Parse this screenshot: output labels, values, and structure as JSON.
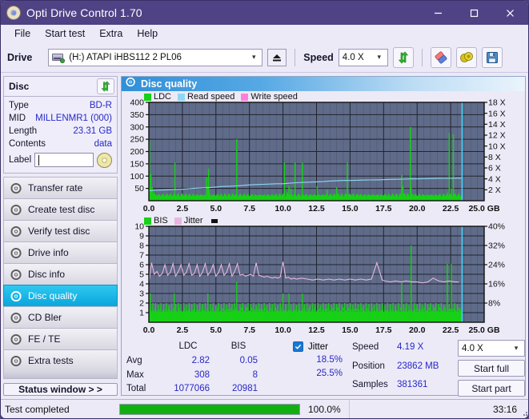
{
  "window": {
    "title": "Opti Drive Control 1.70",
    "icon": "disc-icon",
    "minimize": "minimize-icon",
    "maximize": "maximize-icon",
    "close": "close-icon"
  },
  "menu": {
    "items": [
      "File",
      "Start test",
      "Extra",
      "Help"
    ]
  },
  "toolbar": {
    "drive_label": "Drive",
    "drive_value": "(H:)  ATAPI iHBS112  2 PL06",
    "eject_icon": "eject-icon",
    "speed_label": "Speed",
    "speed_value": "4.0 X",
    "refresh_icon": "refresh-icon",
    "erase_icon": "eraser-icon",
    "coins_icon": "coins-icon",
    "save_icon": "save-icon"
  },
  "disc": {
    "header": "Disc",
    "refresh_icon": "refresh-icon",
    "rows": [
      {
        "key": "Type",
        "value": "BD-R"
      },
      {
        "key": "MID",
        "value": "MILLENMR1 (000)"
      },
      {
        "key": "Length",
        "value": "23.31 GB"
      },
      {
        "key": "Contents",
        "value": "data"
      }
    ],
    "label_key": "Label",
    "label_value": "",
    "label_placeholder": "",
    "disc_icon": "cd-icon"
  },
  "nav": {
    "items": [
      {
        "label": "Transfer rate",
        "icon": "disc-icon",
        "active": false
      },
      {
        "label": "Create test disc",
        "icon": "disc-icon",
        "active": false
      },
      {
        "label": "Verify test disc",
        "icon": "disc-icon",
        "active": false
      },
      {
        "label": "Drive info",
        "icon": "disc-icon",
        "active": false
      },
      {
        "label": "Disc info",
        "icon": "disc-icon",
        "active": false
      },
      {
        "label": "Disc quality",
        "icon": "disc-icon",
        "active": true
      },
      {
        "label": "CD Bler",
        "icon": "disc-icon",
        "active": false
      },
      {
        "label": "FE / TE",
        "icon": "disc-icon",
        "active": false
      },
      {
        "label": "Extra tests",
        "icon": "disc-icon",
        "active": false
      }
    ],
    "status_window": "Status window > >"
  },
  "panel": {
    "title": "Disc quality",
    "icon": "disc-icon"
  },
  "stats": {
    "columns": [
      "LDC",
      "BIS"
    ],
    "rows": [
      {
        "key": "Avg",
        "ldc": "2.82",
        "bis": "0.05"
      },
      {
        "key": "Max",
        "ldc": "308",
        "bis": "8"
      },
      {
        "key": "Total",
        "ldc": "1077066",
        "bis": "20981"
      }
    ],
    "jitter_label": "Jitter",
    "jitter_checked": true,
    "jitter_avg": "18.5%",
    "jitter_max": "25.5%",
    "speed_key": "Speed",
    "speed_value": "4.19 X",
    "position_key": "Position",
    "position_value": "23862 MB",
    "samples_key": "Samples",
    "samples_value": "381361",
    "speed_select": "4.0 X",
    "start_full": "Start full",
    "start_part": "Start part"
  },
  "statusbar": {
    "text": "Test completed",
    "progress": 100,
    "percent": "100.0%",
    "time": "33:16"
  },
  "colors": {
    "titlebar": "#4f4285",
    "accent_blue": "#2828c8",
    "ldc_green": "#17d017",
    "read_speed": "#8fd8f5",
    "write_speed": "#ff7fe0",
    "jitter_pink": "#e8b6e0",
    "plot_bg": "#5f6b89",
    "progress_green": "#11b011",
    "active_nav": "#0aa6dc"
  },
  "chart_data": [
    {
      "type": "line",
      "title": "LDC / Read speed / Write speed",
      "xlabel": "GB",
      "ylabel": "LDC",
      "y2label": "X",
      "xlim": [
        0,
        25
      ],
      "ylim": [
        0,
        400
      ],
      "y2lim": [
        0,
        18
      ],
      "grid": true,
      "legend": [
        "LDC",
        "Read speed",
        "Write speed"
      ],
      "legend_position": "top-left",
      "xticks": [
        "0.0",
        "2.5",
        "5.0",
        "7.5",
        "10.0",
        "12.5",
        "15.0",
        "17.5",
        "20.0",
        "22.5",
        "25.0 GB"
      ],
      "yticks": [
        "50",
        "100",
        "150",
        "200",
        "250",
        "300",
        "350",
        "400"
      ],
      "y2ticks": [
        "2 X",
        "4 X",
        "6 X",
        "8 X",
        "10 X",
        "12 X",
        "14 X",
        "16 X",
        "18 X"
      ],
      "series": [
        {
          "name": "LDC",
          "color": "#17d017",
          "kind": "impulse",
          "x": [
            0.05,
            0.1,
            0.15,
            0.2,
            0.25,
            0.3,
            0.35,
            0.4,
            0.5,
            0.6,
            0.7,
            0.8,
            0.9,
            1.0,
            1.1,
            1.2,
            1.3,
            1.4,
            1.5,
            1.6,
            1.7,
            1.8,
            1.95,
            2.0,
            2.1,
            2.2,
            2.4,
            2.6,
            2.8,
            3.0,
            3.2,
            3.4,
            3.6,
            3.8,
            4.0,
            4.2,
            4.3,
            4.4,
            4.45,
            4.5,
            4.6,
            4.7,
            4.8,
            5.0,
            5.2,
            5.4,
            5.6,
            5.8,
            6.0,
            6.2,
            6.4,
            6.55,
            6.6,
            6.7,
            6.9,
            7.1,
            7.3,
            7.5,
            7.7,
            7.9,
            8.1,
            8.3,
            8.5,
            8.7,
            8.9,
            9.1,
            9.3,
            9.5,
            9.7,
            9.9,
            10.1,
            10.3,
            10.45,
            10.5,
            10.6,
            10.7,
            10.9,
            11.1,
            11.3,
            11.45,
            11.6,
            11.8,
            12.0,
            12.2,
            12.4,
            12.55,
            12.7,
            12.9,
            13.1,
            13.3,
            13.5,
            13.7,
            13.9,
            14.0,
            14.2,
            14.4,
            14.6,
            14.8,
            14.95,
            15.1,
            15.3,
            15.5,
            15.7,
            15.9,
            16.1,
            16.3,
            16.5,
            16.7,
            16.9,
            17.1,
            17.3,
            17.5,
            17.7,
            17.9,
            18.1,
            18.3,
            18.5,
            18.7,
            18.85,
            18.95,
            19.1,
            19.3,
            19.5,
            19.55,
            19.7,
            19.9,
            20.1,
            20.3,
            20.5,
            20.7,
            20.9,
            21.1,
            21.3,
            21.5,
            21.7,
            21.9,
            22.1,
            22.25,
            22.4,
            22.55,
            22.7,
            22.8,
            22.9,
            23.0,
            23.1,
            23.2
          ],
          "y": [
            245,
            60,
            110,
            40,
            55,
            30,
            25,
            35,
            20,
            22,
            18,
            20,
            18,
            22,
            18,
            20,
            18,
            25,
            20,
            22,
            18,
            20,
            155,
            22,
            18,
            20,
            18,
            22,
            20,
            18,
            20,
            18,
            22,
            20,
            18,
            20,
            95,
            60,
            130,
            45,
            20,
            22,
            18,
            20,
            22,
            18,
            20,
            18,
            22,
            18,
            20,
            250,
            22,
            18,
            20,
            22,
            18,
            20,
            22,
            18,
            20,
            22,
            18,
            20,
            22,
            18,
            20,
            22,
            18,
            20,
            155,
            35,
            60,
            25,
            50,
            20,
            155,
            22,
            18,
            155,
            20,
            22,
            18,
            20,
            22,
            60,
            20,
            18,
            22,
            45,
            20,
            18,
            22,
            55,
            20,
            22,
            18,
            155,
            20,
            22,
            18,
            20,
            22,
            18,
            20,
            22,
            18,
            20,
            22,
            18,
            20,
            22,
            18,
            20,
            22,
            18,
            20,
            22,
            105,
            60,
            30,
            22,
            300,
            55,
            25,
            22,
            18,
            20,
            22,
            18,
            20,
            22,
            18,
            20,
            22,
            18,
            20,
            32,
            275,
            50,
            270,
            28,
            20,
            18,
            15,
            12
          ]
        },
        {
          "name": "Read speed",
          "color": "#8fd8f5",
          "kind": "line",
          "x": [
            0.0,
            0.5,
            1.0,
            1.5,
            2.0,
            2.5,
            3.0,
            3.5,
            4.0,
            4.5,
            5.0,
            5.5,
            6.0,
            6.5,
            7.0,
            7.5,
            8.0,
            8.5,
            9.0,
            9.5,
            10.0,
            10.5,
            11.0,
            11.5,
            12.0,
            12.5,
            13.0,
            13.5,
            14.0,
            14.5,
            15.0,
            15.5,
            16.0,
            16.5,
            17.0,
            17.5,
            18.0,
            18.5,
            19.0,
            19.5,
            20.0,
            20.5,
            21.0,
            21.5,
            22.0,
            22.5,
            23.0,
            23.3
          ],
          "y_x_speed": [
            1.85,
            1.9,
            1.95,
            2.0,
            2.05,
            2.1,
            2.2,
            2.3,
            2.35,
            2.4,
            2.5,
            2.6,
            2.65,
            2.7,
            2.8,
            2.9,
            2.95,
            3.0,
            3.05,
            3.1,
            3.1,
            3.2,
            3.3,
            3.35,
            3.4,
            3.45,
            3.5,
            3.6,
            3.65,
            3.7,
            3.7,
            3.75,
            3.78,
            3.8,
            3.82,
            3.85,
            3.9,
            3.92,
            3.95,
            4.0,
            4.0,
            4.02,
            4.05,
            4.08,
            4.1,
            4.1,
            4.12,
            4.12
          ]
        },
        {
          "name": "Write speed",
          "color": "#ff7fe0",
          "kind": "line",
          "x": [],
          "y": []
        }
      ],
      "cursor_x": 23.35,
      "cursor_color": "#3fd0f5"
    },
    {
      "type": "line",
      "title": "BIS / Jitter",
      "xlabel": "GB",
      "ylabel": "BIS",
      "y2label": "%",
      "xlim": [
        0,
        25
      ],
      "ylim": [
        0,
        10
      ],
      "y2lim": [
        0,
        40
      ],
      "grid": true,
      "legend": [
        "BIS",
        "Jitter"
      ],
      "legend_position": "top-left",
      "xticks": [
        "0.0",
        "2.5",
        "5.0",
        "7.5",
        "10.0",
        "12.5",
        "15.0",
        "17.5",
        "20.0",
        "22.5",
        "25.0 GB"
      ],
      "yticks": [
        "1",
        "2",
        "3",
        "4",
        "5",
        "6",
        "7",
        "8",
        "9",
        "10"
      ],
      "y2ticks": [
        "8%",
        "16%",
        "24%",
        "32%",
        "40%"
      ],
      "series": [
        {
          "name": "BIS",
          "color": "#17d017",
          "kind": "impulse",
          "baseline": 1.1,
          "peaks_x": [
            0.1,
            0.3,
            0.5,
            0.7,
            0.9,
            1.1,
            1.3,
            1.5,
            1.7,
            1.9,
            2.0,
            2.2,
            2.4,
            2.6,
            2.8,
            3.0,
            3.2,
            3.4,
            3.6,
            3.8,
            4.0,
            4.2,
            4.4,
            4.6,
            4.8,
            5.0,
            5.2,
            5.4,
            5.6,
            5.8,
            6.0,
            6.2,
            6.4,
            6.55,
            6.8,
            7.0,
            7.2,
            7.4,
            7.6,
            7.8,
            8.0,
            8.2,
            8.4,
            8.6,
            8.8,
            9.0,
            9.2,
            9.4,
            9.6,
            9.8,
            10.0,
            10.2,
            10.45,
            10.6,
            10.8,
            11.0,
            11.2,
            11.45,
            11.6,
            11.8,
            12.0,
            12.2,
            12.4,
            12.6,
            12.8,
            13.0,
            13.2,
            13.4,
            13.6,
            13.8,
            14.0,
            14.2,
            14.4,
            14.6,
            14.8,
            15.0,
            15.2,
            15.4,
            15.6,
            15.8,
            16.0,
            16.2,
            16.4,
            16.6,
            16.8,
            17.0,
            17.2,
            17.4,
            17.6,
            17.8,
            18.0,
            18.2,
            18.4,
            18.6,
            18.85,
            19.0,
            19.2,
            19.4,
            19.55,
            19.8,
            20.0,
            20.2,
            20.4,
            20.6,
            20.8,
            21.0,
            21.2,
            21.4,
            21.6,
            21.8,
            22.0,
            22.25,
            22.4,
            22.55,
            22.8,
            23.0,
            23.2
          ],
          "peaks_y": [
            3.0,
            2.0,
            2.0,
            1.8,
            2.0,
            1.9,
            2.0,
            1.8,
            2.0,
            3.0,
            1.9,
            2.0,
            1.9,
            2.0,
            1.8,
            2.0,
            1.9,
            2.0,
            1.8,
            2.0,
            1.9,
            2.0,
            3.0,
            1.9,
            2.0,
            1.8,
            2.0,
            1.9,
            2.0,
            1.8,
            2.0,
            1.9,
            2.0,
            4.2,
            1.9,
            2.0,
            1.8,
            2.0,
            1.9,
            2.0,
            1.8,
            2.0,
            1.9,
            2.0,
            1.8,
            2.0,
            1.9,
            2.0,
            1.8,
            2.0,
            3.0,
            1.9,
            3.0,
            1.9,
            2.0,
            1.8,
            2.0,
            3.0,
            1.9,
            2.0,
            1.8,
            2.0,
            1.9,
            2.0,
            1.8,
            2.0,
            1.9,
            2.0,
            1.8,
            2.0,
            1.9,
            2.0,
            1.8,
            2.0,
            1.9,
            2.0,
            1.8,
            2.0,
            1.9,
            2.0,
            1.8,
            2.0,
            1.9,
            2.0,
            1.8,
            2.0,
            1.9,
            2.0,
            1.8,
            2.0,
            1.9,
            2.0,
            1.8,
            2.0,
            4.1,
            1.9,
            2.0,
            1.8,
            8.0,
            2.0,
            1.9,
            2.0,
            1.8,
            2.0,
            1.9,
            2.0,
            1.8,
            2.0,
            1.9,
            2.0,
            1.8,
            6.1,
            1.9,
            6.1,
            2.0,
            1.9,
            1.5
          ]
        },
        {
          "name": "Jitter",
          "color": "#e8b6e0",
          "kind": "line",
          "avg_pct": 18.5,
          "max_pct": 25.5,
          "x": [
            0.0,
            0.2,
            0.4,
            0.6,
            0.8,
            1.0,
            1.2,
            1.4,
            1.6,
            1.8,
            2.0,
            2.2,
            2.4,
            2.6,
            2.8,
            3.0,
            3.2,
            3.4,
            3.6,
            3.8,
            4.0,
            4.2,
            4.4,
            4.6,
            4.8,
            5.0,
            5.2,
            5.4,
            5.6,
            5.8,
            6.0,
            6.2,
            6.4,
            6.6,
            6.8,
            7.0,
            7.2,
            7.4,
            7.6,
            7.8,
            8.0,
            8.2,
            8.4,
            8.6,
            8.8,
            9.0,
            9.2,
            9.4,
            9.6,
            9.8,
            10.0,
            10.2,
            10.4,
            10.6,
            10.8,
            11.0,
            11.4,
            11.8,
            12.2,
            12.6,
            13.0,
            13.4,
            13.8,
            14.2,
            14.6,
            15.0,
            15.4,
            15.8,
            16.2,
            16.6,
            17.0,
            17.4,
            17.6,
            18.0,
            18.4,
            18.8,
            19.2,
            19.6,
            20.0,
            20.4,
            20.8,
            21.2,
            21.6,
            22.0,
            22.4,
            22.8,
            23.1
          ],
          "y_bis_scale": [
            4.1,
            6.2,
            5.0,
            5.3,
            4.8,
            5.1,
            6.0,
            4.9,
            5.2,
            6.1,
            4.8,
            5.3,
            6.0,
            4.9,
            5.2,
            6.1,
            4.9,
            5.1,
            6.0,
            4.8,
            5.2,
            6.1,
            4.9,
            5.3,
            6.0,
            4.8,
            5.2,
            6.0,
            4.9,
            5.2,
            6.1,
            4.8,
            5.3,
            6.1,
            4.9,
            5.0,
            4.8,
            4.9,
            5.0,
            4.8,
            6.2,
            4.9,
            4.8,
            4.7,
            4.8,
            4.7,
            4.6,
            4.7,
            4.6,
            4.7,
            6.3,
            4.6,
            4.7,
            4.5,
            4.6,
            4.5,
            4.6,
            4.5,
            4.4,
            4.5,
            4.4,
            4.5,
            4.4,
            4.5,
            4.4,
            4.5,
            4.4,
            4.5,
            4.4,
            4.5,
            6.2,
            4.4,
            4.3,
            4.2,
            4.3,
            4.2,
            4.3,
            4.2,
            4.2,
            4.1,
            4.2,
            4.6,
            4.3,
            4.2,
            4.3,
            4.2,
            4.2
          ]
        }
      ],
      "cursor_x": 23.35,
      "cursor_color": "#3fd0f5"
    }
  ]
}
